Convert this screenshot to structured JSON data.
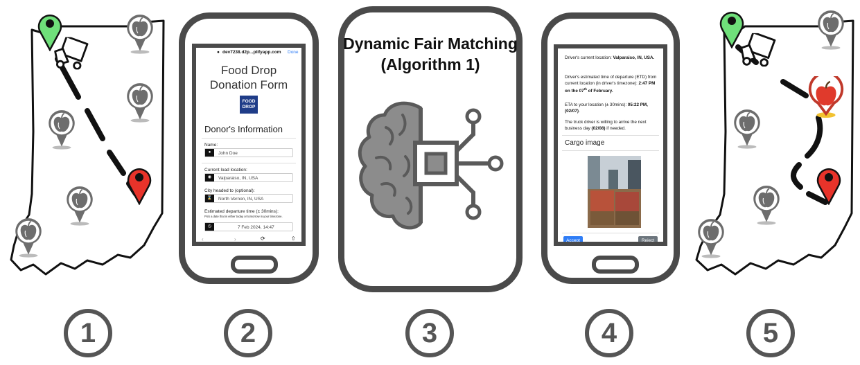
{
  "steps": [
    "1",
    "2",
    "3",
    "4",
    "5"
  ],
  "panel2": {
    "url": "dev7238.d2p...plifyapp.com",
    "done": "Done",
    "title_line1": "Food Drop",
    "title_line2": "Donation Form",
    "logo_line1": "FOOD",
    "logo_line2": "DROP",
    "section": "Donor's Information",
    "name_label": "Name:",
    "name_value": "John Doe",
    "load_label": "Current load location:",
    "load_value": "Valparaiso, IN, USA",
    "city_label": "City headed to (optional):",
    "city_value": "North Vernon, IN, USA",
    "time_label": "Estimated departure time (± 30mins):",
    "time_hint": "Pick a date that is either today or tomorrow in your timezone.",
    "time_value": "7 Feb 2024, 14:47"
  },
  "panel3": {
    "title_line1": "Dynamic Fair Matching",
    "title_line2": "(Algorithm 1)"
  },
  "panel4": {
    "loc_prefix": "Driver's current location: ",
    "loc_value": "Valparaiso, IN, USA.",
    "etd_prefix": "Driver's estimated time of departure (ETD) from current location (in driver's timezone): ",
    "etd_value": "2:47 PM on the 07",
    "etd_sup": "th",
    "etd_suffix": " of February.",
    "eta_prefix": "ETA to your location (± 30mins): ",
    "eta_value": "05:22 PM, (02/07)",
    "eta_end": ".",
    "next_prefix": "The truck driver is willing to arrive the next business day ",
    "next_value": "(02/08)",
    "next_suffix": " if needed.",
    "cargo_title": "Cargo image",
    "accept": "Accept",
    "reject": "Reject"
  },
  "colors": {
    "origin_pin": "#6fe07a",
    "destination_pin": "#e8332a",
    "apple_gray": "#6d6d6d",
    "apple_red": "#e03a2c",
    "apple_highlight_ring": "#c0392b",
    "accept_button": "#2f7df6",
    "reject_button": "#6c757d",
    "outline": "#4a4a4a"
  },
  "icons": [
    "truck-icon",
    "apple-pin-icon",
    "location-pin-icon",
    "brain-chip-icon",
    "lock-icon",
    "user-icon",
    "camera-icon",
    "hourglass-icon",
    "clock-icon",
    "share-icon",
    "refresh-icon"
  ]
}
